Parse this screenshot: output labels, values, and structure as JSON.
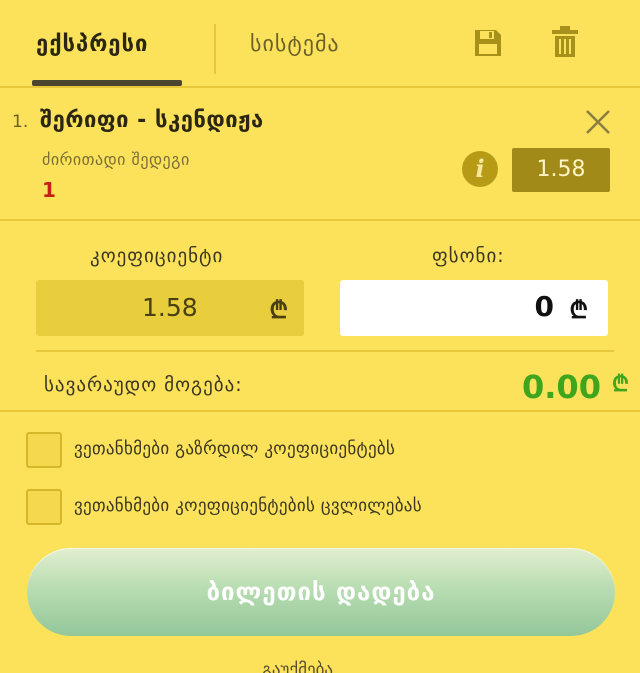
{
  "tabs": {
    "express": "ექსპრესი",
    "system": "სისტემა"
  },
  "icons": {
    "save": "save-icon",
    "trash": "trash-icon",
    "close": "close-icon",
    "info": "i"
  },
  "bet": {
    "index": "1.",
    "title": "შერიფი - სკენდიჟა",
    "market": "ძირითადი შედეგი",
    "pick": "1",
    "odds": "1.58"
  },
  "coefficient": {
    "label": "კოეფიციენტი",
    "value": "1.58",
    "currency": "₾"
  },
  "stake": {
    "label": "ფსონი:",
    "value": "0",
    "currency": "₾"
  },
  "payout": {
    "label": "სავარაუდო მოგება:",
    "value": "0.00",
    "currency": "₾"
  },
  "options": {
    "accept_higher": "ვეთანხმები გაზრდილ კოეფიციენტებს",
    "accept_changes": "ვეთანხმები კოეფიციენტების ცვლილებას"
  },
  "place_bet_label": "ბილეთის დადება",
  "bottom_link": "გაუქმება",
  "colors": {
    "background": "#fbe25a",
    "odds_badge": "#a18a18",
    "payout": "#3ea51c",
    "pick": "#c42016"
  }
}
